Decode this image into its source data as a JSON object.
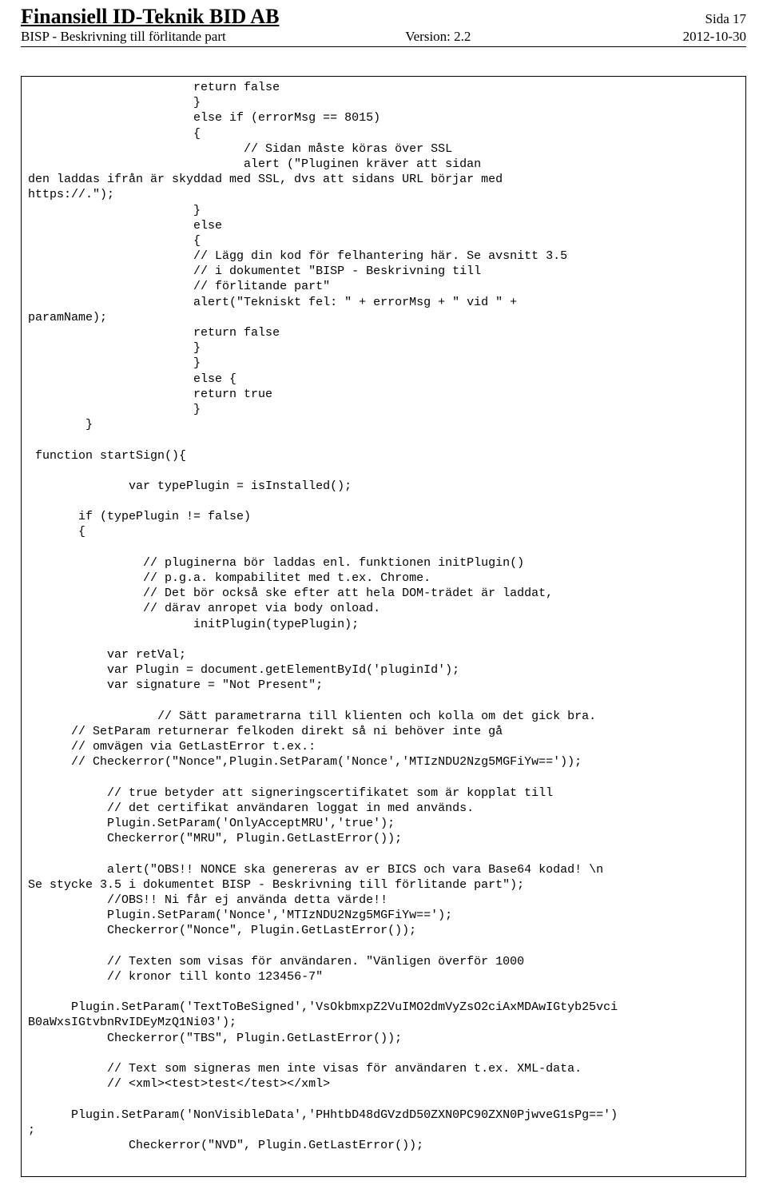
{
  "header": {
    "company": "Finansiell ID-Teknik BID AB",
    "page_label": "Sida 17",
    "doc_title": "BISP - Beskrivning till förlitande part",
    "version": "Version: 2.2",
    "date": "2012-10-30"
  },
  "code": "                       return false\n                       }\n                       else if (errorMsg == 8015)\n                       {\n                              // Sidan måste köras över SSL\n                              alert (\"Pluginen kräver att sidan\nden laddas ifrån är skyddad med SSL, dvs att sidans URL börjar med\nhttps://.\");\n                       }\n                       else\n                       {\n                       // Lägg din kod för felhantering här. Se avsnitt 3.5\n                       // i dokumentet \"BISP - Beskrivning till\n                       // förlitande part\"\n                       alert(\"Tekniskt fel: \" + errorMsg + \" vid \" +\nparamName);\n                       return false\n                       }\n                       }\n                       else {\n                       return true\n                       }\n        }\n\n function startSign(){\n\n              var typePlugin = isInstalled();\n\n       if (typePlugin != false)\n       {\n\n                // pluginerna bör laddas enl. funktionen initPlugin()\n                // p.g.a. kompabilitet med t.ex. Chrome.\n                // Det bör också ske efter att hela DOM-trädet är laddat,\n                // därav anropet via body onload.\n                       initPlugin(typePlugin);\n\n           var retVal;\n           var Plugin = document.getElementById('pluginId');\n           var signature = \"Not Present\";\n\n                  // Sätt parametrarna till klienten och kolla om det gick bra.\n      // SetParam returnerar felkoden direkt så ni behöver inte gå\n      // omvägen via GetLastError t.ex.:\n      // Checkerror(\"Nonce\",Plugin.SetParam('Nonce','MTIzNDU2Nzg5MGFiYw=='));\n\n           // true betyder att signeringscertifikatet som är kopplat till\n           // det certifikat användaren loggat in med används.\n           Plugin.SetParam('OnlyAcceptMRU','true');\n           Checkerror(\"MRU\", Plugin.GetLastError());\n\n           alert(\"OBS!! NONCE ska genereras av er BICS och vara Base64 kodad! \\n\nSe stycke 3.5 i dokumentet BISP - Beskrivning till förlitande part\");\n           //OBS!! Ni får ej använda detta värde!!\n           Plugin.SetParam('Nonce','MTIzNDU2Nzg5MGFiYw==');\n           Checkerror(\"Nonce\", Plugin.GetLastError());\n\n           // Texten som visas för användaren. \"Vänligen överför 1000\n           // kronor till konto 123456-7\"\n\n      Plugin.SetParam('TextToBeSigned','VsOkbmxpZ2VuIMO2dmVyZsO2ciAxMDAwIGtyb25vci\nB0aWxsIGtvbnRvIDEyMzQ1Ni03');\n           Checkerror(\"TBS\", Plugin.GetLastError());\n\n           // Text som signeras men inte visas för användaren t.ex. XML-data.\n           // <xml><test>test</test></xml>\n\n      Plugin.SetParam('NonVisibleData','PHhtbD48dGVzdD50ZXN0PC90ZXN0PjwveG1sPg==')\n;\n              Checkerror(\"NVD\", Plugin.GetLastError());"
}
